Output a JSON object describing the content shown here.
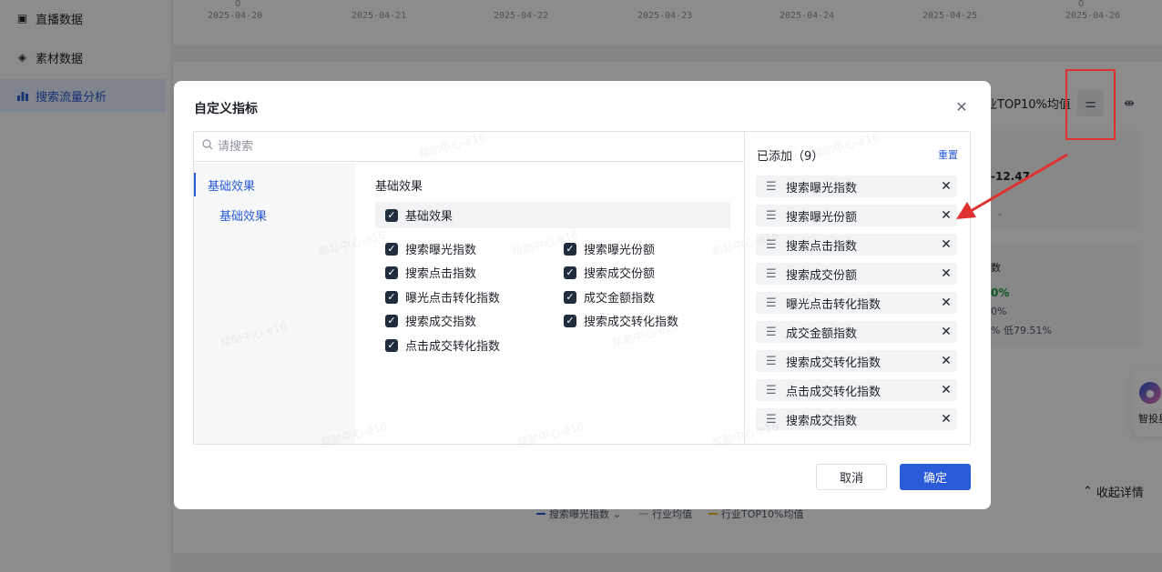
{
  "sidebar": {
    "items": [
      {
        "label": "直播数据",
        "icon": "live-icon"
      },
      {
        "label": "素材数据",
        "icon": "layers-icon"
      },
      {
        "label": "搜索流量分析",
        "icon": "bar-chart-icon",
        "active": true
      }
    ]
  },
  "chart_top": {
    "zero_label": "0",
    "dates": [
      "2025-04-20",
      "2025-04-21",
      "2025-04-22",
      "2025-04-23",
      "2025-04-24",
      "2025-04-25",
      "2025-04-26"
    ]
  },
  "background": {
    "header_text": "业TOP10%均值",
    "kpi1_value": "-12.47",
    "kpi1_sub": "-",
    "kpi2_title": "数",
    "kpi2_value": "0%",
    "kpi2_sub1": "0%",
    "kpi2_sub2": "% 低79.51%",
    "legend": [
      {
        "label": "搜索曝光指数",
        "color": "#2b5bd7"
      },
      {
        "label": "行业均值",
        "color": "#c9cdd4"
      },
      {
        "label": "行业TOP10%均值",
        "color": "#f7ba1e"
      }
    ],
    "collapse_label": "收起详情",
    "widget_label": "智投星"
  },
  "modal": {
    "title": "自定义指标",
    "search_placeholder": "请搜索",
    "nav_group": "基础效果",
    "nav_sub": "基础效果",
    "section_title": "基础效果",
    "group_label": "基础效果",
    "options": [
      {
        "label": "搜索曝光指数",
        "checked": true
      },
      {
        "label": "搜索曝光份额",
        "checked": true
      },
      {
        "label": "搜索点击指数",
        "checked": true
      },
      {
        "label": "搜索成交份额",
        "checked": true
      },
      {
        "label": "曝光点击转化指数",
        "checked": true
      },
      {
        "label": "成交金额指数",
        "checked": true
      },
      {
        "label": "搜索成交指数",
        "checked": true
      },
      {
        "label": "搜索成交转化指数",
        "checked": true
      },
      {
        "label": "点击成交转化指数",
        "checked": true
      }
    ],
    "added_title": "已添加（9）",
    "reset_label": "重置",
    "added": [
      "搜索曝光指数",
      "搜索曝光份额",
      "搜索点击指数",
      "搜索成交份额",
      "曝光点击转化指数",
      "成交金额指数",
      "搜索成交转化指数",
      "点击成交转化指数",
      "搜索成交指数"
    ],
    "cancel_label": "取消",
    "ok_label": "确定",
    "watermark": "帮助中心-e16"
  },
  "colors": {
    "accent": "#2b5bd7",
    "highlight": "#e03131",
    "arrow": "#e03131"
  }
}
